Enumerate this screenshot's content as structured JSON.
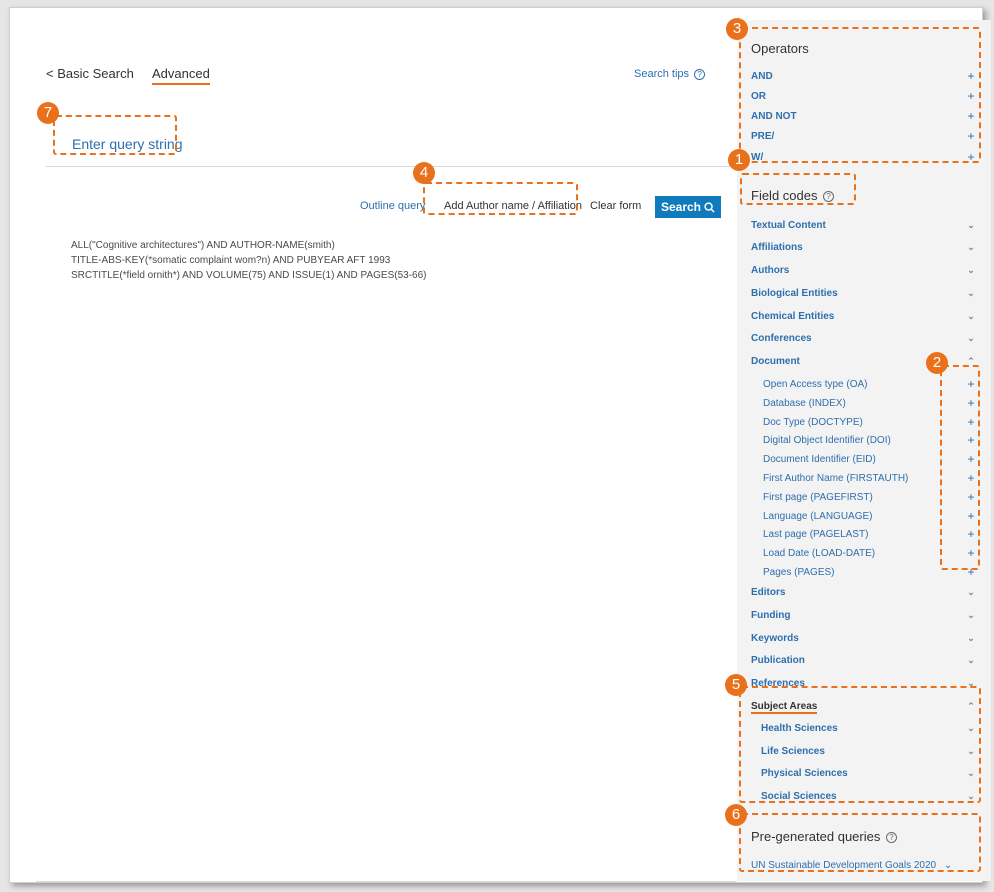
{
  "nav": {
    "back_label": "< Basic Search",
    "active_tab": "Advanced"
  },
  "search_tips": "Search tips",
  "query_heading": "Enter query string",
  "actions": {
    "outline": "Outline query",
    "add_author": "Add Author name / Affiliation",
    "clear": "Clear form",
    "search": "Search"
  },
  "queries": [
    "ALL(\"Cognitive architectures\") AND AUTHOR-NAME(smith)",
    "TITLE-ABS-KEY(*somatic complaint wom?n) AND PUBYEAR AFT 1993",
    "SRCTITLE(*field ornith*) AND VOLUME(75) AND ISSUE(1) AND PAGES(53-66)"
  ],
  "operators": {
    "title": "Operators",
    "items": [
      "AND",
      "OR",
      "AND NOT",
      "PRE/",
      "W/"
    ]
  },
  "field_codes": {
    "title": "Field codes",
    "categories": [
      "Textual Content",
      "Affiliations",
      "Authors",
      "Biological Entities",
      "Chemical Entities",
      "Conferences",
      "Document"
    ],
    "document_items": [
      "Open Access type (OA)",
      "Database (INDEX)",
      "Doc Type (DOCTYPE)",
      "Digital Object Identifier (DOI)",
      "Document Identifier (EID)",
      "First Author Name (FIRSTAUTH)",
      "First page (PAGEFIRST)",
      "Language (LANGUAGE)",
      "Last page (PAGELAST)",
      "Load Date (LOAD-DATE)",
      "Pages (PAGES)"
    ],
    "categories_after": [
      "Editors",
      "Funding",
      "Keywords",
      "Publication",
      "References"
    ]
  },
  "subject_areas": {
    "title": "Subject Areas",
    "items": [
      "Health Sciences",
      "Life Sciences",
      "Physical Sciences",
      "Social Sciences"
    ]
  },
  "pregenerated": {
    "title": "Pre-generated queries",
    "item": "UN Sustainable Development Goals 2020"
  },
  "callouts": [
    "1",
    "2",
    "3",
    "4",
    "5",
    "6",
    "7"
  ],
  "colors": {
    "accent": "#e9711c",
    "link": "#2e6fad",
    "button": "#0f7bbd"
  }
}
